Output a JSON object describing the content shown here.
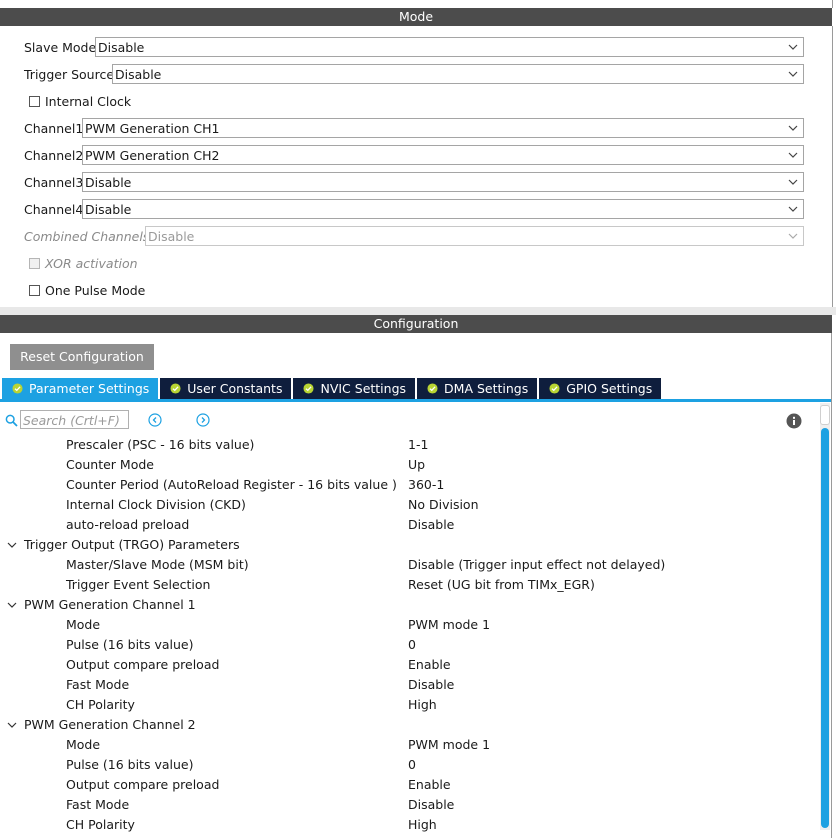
{
  "mode": {
    "title": "Mode",
    "fields": [
      {
        "label": "Slave Mode",
        "value": "Disable"
      },
      {
        "label": "Trigger Source",
        "value": "Disable"
      },
      {
        "label": "Channel1",
        "value": "PWM Generation CH1"
      },
      {
        "label": "Channel2",
        "value": "PWM Generation CH2"
      },
      {
        "label": "Channel3",
        "value": "Disable"
      },
      {
        "label": "Channel4",
        "value": "Disable"
      },
      {
        "label": "Combined Channels",
        "value": "Disable"
      }
    ],
    "checkboxes": {
      "internal_clock": {
        "label": "Internal Clock",
        "checked": false
      },
      "xor_activation": {
        "label": "XOR activation",
        "checked": false
      },
      "one_pulse_mode": {
        "label": "One Pulse Mode",
        "checked": false
      }
    }
  },
  "config": {
    "title": "Configuration",
    "reset_label": "Reset Configuration",
    "tabs": [
      {
        "label": "Parameter Settings",
        "active": true
      },
      {
        "label": "User Constants",
        "active": false
      },
      {
        "label": "NVIC Settings",
        "active": false
      },
      {
        "label": "DMA Settings",
        "active": false
      },
      {
        "label": "GPIO Settings",
        "active": false
      }
    ],
    "search_placeholder": "Search (Crtl+F)",
    "rows": [
      {
        "name": "Prescaler (PSC - 16 bits value)",
        "value": "1-1"
      },
      {
        "name": "Counter Mode",
        "value": "Up"
      },
      {
        "name": "Counter Period (AutoReload Register - 16 bits value )",
        "value": "360-1"
      },
      {
        "name": "Internal Clock Division (CKD)",
        "value": "No Division"
      },
      {
        "name": "auto-reload preload",
        "value": "Disable"
      },
      {
        "group": "Trigger Output (TRGO) Parameters"
      },
      {
        "name": "Master/Slave Mode (MSM bit)",
        "value": "Disable (Trigger input effect not delayed)"
      },
      {
        "name": "Trigger Event Selection",
        "value": "Reset (UG bit from TIMx_EGR)"
      },
      {
        "group": "PWM Generation Channel 1"
      },
      {
        "name": "Mode",
        "value": "PWM mode 1"
      },
      {
        "name": "Pulse (16 bits value)",
        "value": "0"
      },
      {
        "name": "Output compare preload",
        "value": "Enable"
      },
      {
        "name": "Fast Mode",
        "value": "Disable"
      },
      {
        "name": "CH Polarity",
        "value": "High"
      },
      {
        "group": "PWM Generation Channel 2"
      },
      {
        "name": "Mode",
        "value": "PWM mode 1"
      },
      {
        "name": "Pulse (16 bits value)",
        "value": "0"
      },
      {
        "name": "Output compare preload",
        "value": "Enable"
      },
      {
        "name": "Fast Mode",
        "value": "Disable"
      },
      {
        "name": "CH Polarity",
        "value": "High"
      }
    ]
  },
  "colors": {
    "accent": "#1da1e2",
    "tab_dark": "#0f1e3d",
    "header_bar": "#4c4c4c",
    "check_green": "#b8d433"
  },
  "icons": [
    "search-icon",
    "chevron-down-icon",
    "circle-left-icon",
    "circle-right-icon",
    "info-icon",
    "check-circle-icon"
  ]
}
